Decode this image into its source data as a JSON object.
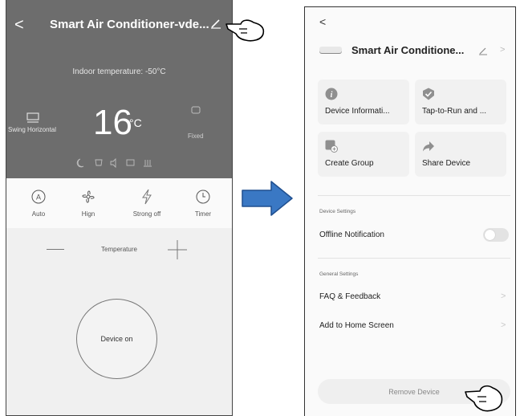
{
  "left": {
    "header": {
      "back_glyph": "<",
      "title": "Smart Air Conditioner-vde...",
      "edit_icon": "pencil-icon"
    },
    "indoor_temperature": "Indoor temperature: -50°C",
    "set_temperature": "16",
    "unit": "°C",
    "swing_label": "Swing Horizontal",
    "fixed_label": "Fixed",
    "modes": [
      {
        "label": "Auto",
        "icon": "auto-a-icon"
      },
      {
        "label": "Hign",
        "icon": "fan-icon"
      },
      {
        "label": "Strong off",
        "icon": "bolt-icon"
      },
      {
        "label": "Timer",
        "icon": "clock-icon"
      }
    ],
    "temperature_label": "Temperature",
    "device_on_label": "Device on"
  },
  "right": {
    "back_glyph": "<",
    "title": "Smart Air Conditione...",
    "tiles": [
      {
        "label": "Device Informati...",
        "icon": "info-icon"
      },
      {
        "label": "Tap-to-Run and ...",
        "icon": "check-shield-icon"
      },
      {
        "label": "Create Group",
        "icon": "create-group-icon"
      },
      {
        "label": "Share Device",
        "icon": "share-arrow-icon"
      }
    ],
    "device_settings_header": "Device Settings",
    "offline_notification_label": "Offline Notification",
    "offline_notification_on": false,
    "general_settings_header": "General Settings",
    "faq_label": "FAQ & Feedback",
    "add_home_label": "Add to Home Screen",
    "remove_device_label": "Remove Device",
    "chevron_glyph": ">"
  },
  "colors": {
    "left_header_bg": "#6d6d6d",
    "arrow_fill": "#3a78c4",
    "arrow_stroke": "#1f4f8f"
  }
}
